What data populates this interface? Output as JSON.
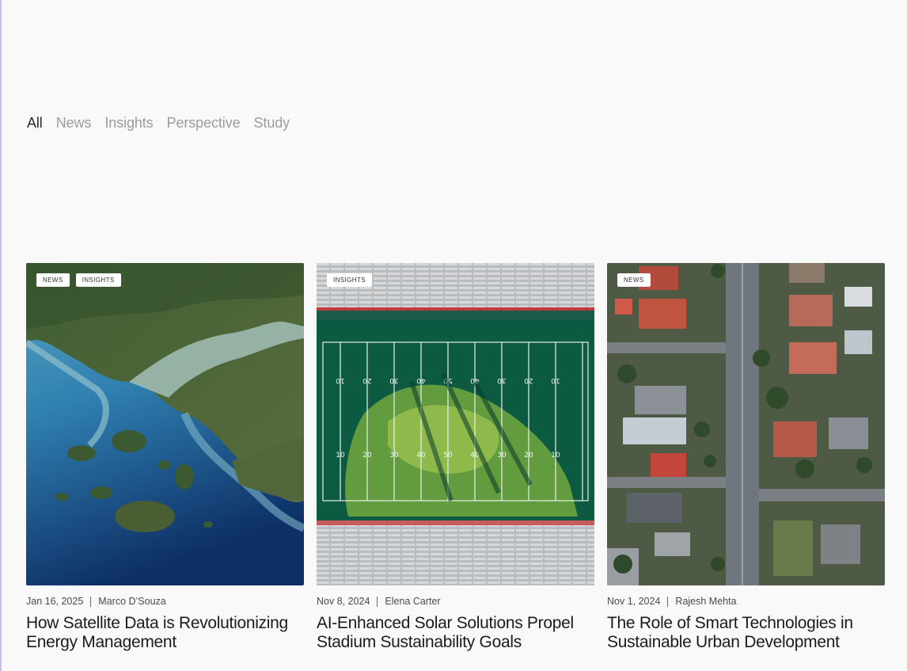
{
  "filters": [
    {
      "label": "All",
      "active": true
    },
    {
      "label": "News",
      "active": false
    },
    {
      "label": "Insights",
      "active": false
    },
    {
      "label": "Perspective",
      "active": false
    },
    {
      "label": "Study",
      "active": false
    }
  ],
  "cards": [
    {
      "tags": [
        "NEWS",
        "INSIGHTS"
      ],
      "date": "Jan 16, 2025",
      "author": "Marco D’Souza",
      "title": "How Satellite Data is Revolutionizing Energy Management",
      "image": "satellite-coastline"
    },
    {
      "tags": [
        "INSIGHTS"
      ],
      "date": "Nov 8, 2024",
      "author": "Elena Carter",
      "title": "AI-Enhanced Solar Solutions Propel Stadium Sustainability Goals",
      "image": "stadium-aerial",
      "field_numbers_top": [
        "10",
        "20",
        "30",
        "40",
        "50",
        "40",
        "30",
        "20",
        "10"
      ],
      "field_numbers_bottom": [
        "10",
        "20",
        "30",
        "40",
        "50",
        "40",
        "30",
        "20",
        "10"
      ]
    },
    {
      "tags": [
        "NEWS"
      ],
      "date": "Nov 1, 2024",
      "author": "Rajesh Mehta",
      "title": "The Role of Smart Technologies in Sustainable Urban Development",
      "image": "suburb-aerial"
    }
  ],
  "colors": {
    "accent_border": "#c9b8f2",
    "filter_active": "#2a2a2c",
    "filter_inactive": "#9c9c9f"
  }
}
